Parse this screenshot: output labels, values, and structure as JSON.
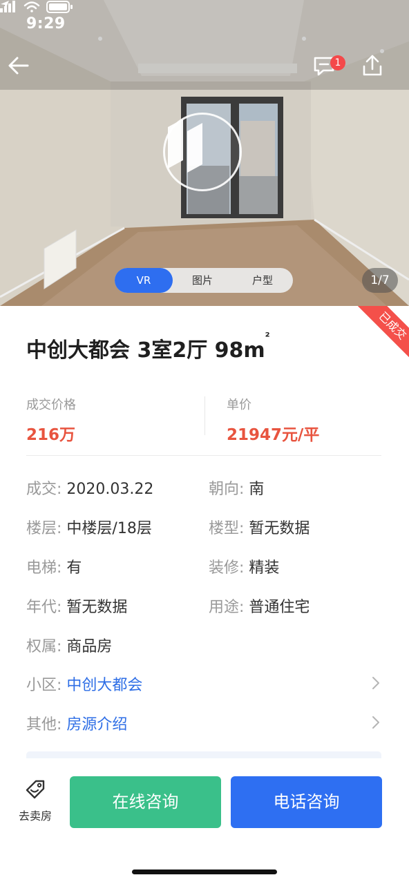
{
  "status_bar": {
    "time": "9:29"
  },
  "header": {
    "chat_badge_count": "1"
  },
  "media": {
    "tabs": [
      {
        "label": "VR",
        "active": true
      },
      {
        "label": "图片",
        "active": false
      },
      {
        "label": "户型",
        "active": false
      }
    ],
    "counter": "1/7"
  },
  "listing": {
    "sold_tag": "已成交",
    "title": "中创大都会 3室2厅 98m",
    "title_superscript": "²",
    "price": {
      "label": "成交价格",
      "value": "216万"
    },
    "unit_price": {
      "label": "单价",
      "value": "21947元/平"
    }
  },
  "details": {
    "deal_date": {
      "label": "成交:",
      "value": "2020.03.22"
    },
    "orientation": {
      "label": "朝向:",
      "value": "南"
    },
    "floor": {
      "label": "楼层:",
      "value": "中楼层/18层"
    },
    "building_type": {
      "label": "楼型:",
      "value": "暂无数据"
    },
    "elevator": {
      "label": "电梯:",
      "value": "有"
    },
    "decoration": {
      "label": "装修:",
      "value": "精装"
    },
    "year": {
      "label": "年代:",
      "value": "暂无数据"
    },
    "usage": {
      "label": "用途:",
      "value": "普通住宅"
    },
    "ownership": {
      "label": "权属:",
      "value": "商品房"
    },
    "community": {
      "label": "小区:",
      "value": "中创大都会"
    },
    "other": {
      "label": "其他:",
      "value": "房源介绍"
    }
  },
  "bottom_bar": {
    "sell_label": "去卖房",
    "online_consult": "在线咨询",
    "phone_consult": "电话咨询"
  },
  "colors": {
    "accent_blue": "#2e6ff2",
    "price_red": "#e8543f",
    "consult_green": "#3ac08a",
    "sold_red": "#f4504a"
  }
}
